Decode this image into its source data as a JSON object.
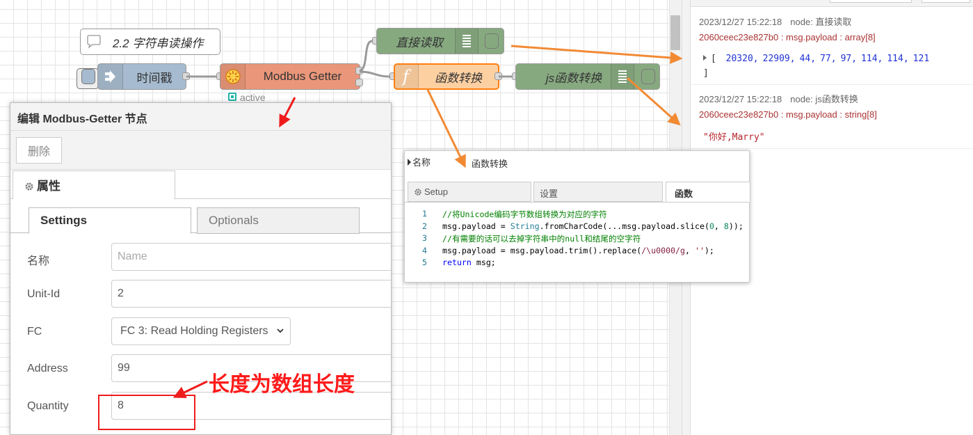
{
  "flow": {
    "comment": "2.2 字符串读操作",
    "nodes": {
      "inject": "时间戳",
      "modbus_getter": "Modbus Getter",
      "modbus_status": "active",
      "direct_debug": "直接读取",
      "function": "函数转换",
      "js_debug": "js函数转换"
    }
  },
  "debug_sidebar": {
    "messages": [
      {
        "timestamp": "2023/12/27 15:22:18",
        "node": "node: 直接读取",
        "topic": "2060ceec23e827b0 : msg.payload : array[8]",
        "value_open": "[",
        "values": [
          "20320,",
          "22909,",
          "44,",
          "77,",
          "97,",
          "114,",
          "114,",
          "121"
        ],
        "value_close": "]"
      },
      {
        "timestamp": "2023/12/27 15:22:18",
        "node": "node: js函数转换",
        "topic": "2060ceec23e827b0 : msg.payload : string[8]",
        "value": "\"你好,Marry\""
      }
    ]
  },
  "edit_tray": {
    "title": "编辑 Modbus-Getter 节点",
    "delete_label": "删除",
    "tab_properties": "属性",
    "subtab_settings": "Settings",
    "subtab_optionals": "Optionals",
    "fields": {
      "name": {
        "label": "名称",
        "placeholder": "Name",
        "value": ""
      },
      "unit_id": {
        "label": "Unit-Id",
        "value": "2"
      },
      "fc": {
        "label": "FC",
        "value": "FC 3: Read Holding Registers"
      },
      "address": {
        "label": "Address",
        "value": "99"
      },
      "quantity": {
        "label": "Quantity",
        "value": "8"
      }
    }
  },
  "function_popup": {
    "name_label": "名称",
    "name_value": "函数转换",
    "tabs": {
      "setup": "Setup",
      "settings": "设置",
      "function": "函数"
    },
    "code_lines": [
      {
        "no": "1",
        "text": "//将Unicode编码字节数组转换为对应的字符"
      },
      {
        "no": "2",
        "text": "msg.payload = String.fromCharCode(...msg.payload.slice(0, 8));"
      },
      {
        "no": "3",
        "text": "//有需要的话可以去掉字符串中的null和结尾的空字符"
      },
      {
        "no": "4",
        "text": "msg.payload = msg.payload.trim().replace(/\\u0000/g, '');"
      },
      {
        "no": "5",
        "text": "return msg;"
      }
    ]
  },
  "annotation": {
    "text": "长度为数组长度"
  },
  "colors": {
    "inject_node": "#a6bbcf",
    "modbus_node": "#e9967a",
    "function_node": "#fdd0a2",
    "debug_node": "#87a980",
    "arrow": "#f28a34",
    "annotation_red": "#ef1c1c"
  }
}
